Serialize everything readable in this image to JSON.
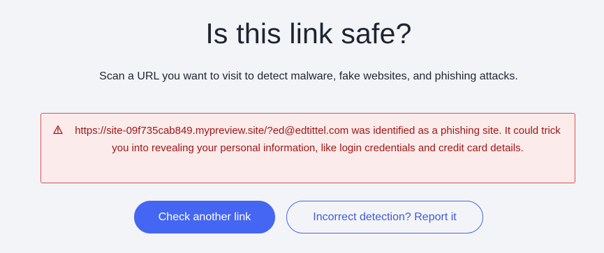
{
  "header": {
    "title": "Is this link safe?",
    "subtitle": "Scan a URL you want to visit to detect malware, fake websites, and phishing attacks."
  },
  "alert": {
    "icon": "warning-triangle-icon",
    "message": "https://site-09f735cab849.mypreview.site/?ed@edtittel.com was identified as a phishing site. It could trick you into revealing your personal information, like login credentials and credit card details.",
    "colors": {
      "background": "#fcebeb",
      "border": "#d9534f",
      "text": "#a01616"
    }
  },
  "actions": {
    "check_another_label": "Check another link",
    "report_label": "Incorrect detection? Report it"
  },
  "colors": {
    "accent": "#4466f2",
    "page_background": "#f3f4f8"
  }
}
